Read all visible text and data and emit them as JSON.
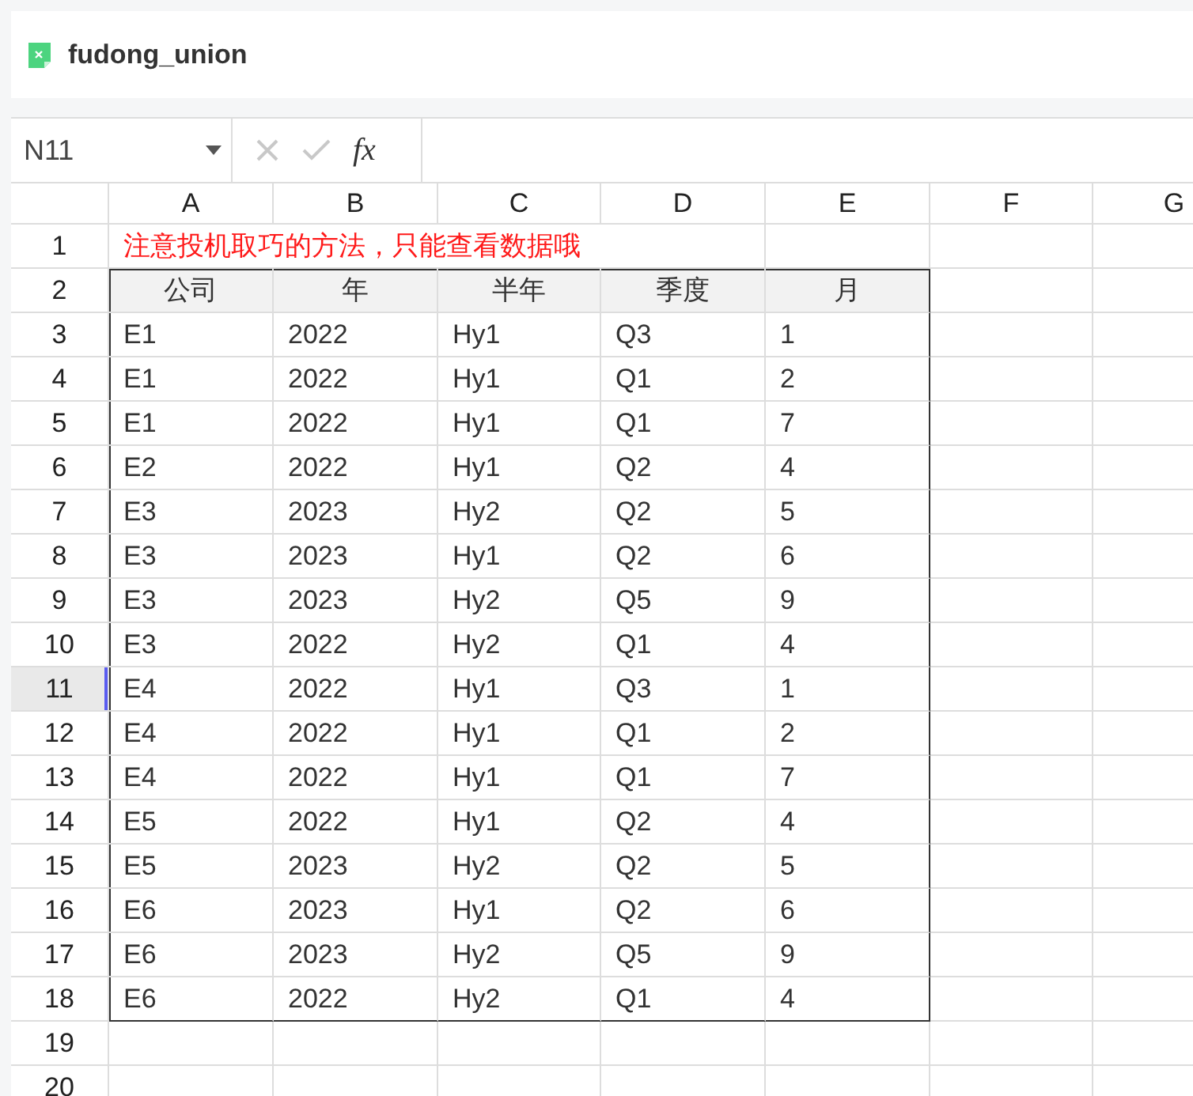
{
  "window": {
    "title": "fudong_union"
  },
  "formula_bar": {
    "name_box": "N11",
    "function_label": "fx"
  },
  "columns": [
    {
      "label": "A",
      "selected": false
    },
    {
      "label": "B",
      "selected": false
    },
    {
      "label": "C",
      "selected": false
    },
    {
      "label": "D",
      "selected": false
    },
    {
      "label": "E",
      "selected": false
    },
    {
      "label": "F",
      "selected": false
    },
    {
      "label": "G",
      "selected": false
    }
  ],
  "rows": [
    {
      "label": "1",
      "selected": false,
      "kind": "note",
      "cells": [
        "注意投机取巧的方法，只能查看数据哦"
      ]
    },
    {
      "label": "2",
      "selected": false,
      "kind": "header",
      "cells": [
        "公司",
        "年",
        "半年",
        "季度",
        "月"
      ]
    },
    {
      "label": "3",
      "selected": false,
      "kind": "data",
      "cells": [
        "E1",
        "2022",
        "Hy1",
        "Q3",
        "1"
      ]
    },
    {
      "label": "4",
      "selected": false,
      "kind": "data",
      "cells": [
        "E1",
        "2022",
        "Hy1",
        "Q1",
        "2"
      ]
    },
    {
      "label": "5",
      "selected": false,
      "kind": "data",
      "cells": [
        "E1",
        "2022",
        "Hy1",
        "Q1",
        "7"
      ]
    },
    {
      "label": "6",
      "selected": false,
      "kind": "data",
      "cells": [
        "E2",
        "2022",
        "Hy1",
        "Q2",
        "4"
      ]
    },
    {
      "label": "7",
      "selected": false,
      "kind": "data",
      "cells": [
        "E3",
        "2023",
        "Hy2",
        "Q2",
        "5"
      ]
    },
    {
      "label": "8",
      "selected": false,
      "kind": "data",
      "cells": [
        "E3",
        "2023",
        "Hy1",
        "Q2",
        "6"
      ]
    },
    {
      "label": "9",
      "selected": false,
      "kind": "data",
      "cells": [
        "E3",
        "2023",
        "Hy2",
        "Q5",
        "9"
      ]
    },
    {
      "label": "10",
      "selected": false,
      "kind": "data",
      "cells": [
        "E3",
        "2022",
        "Hy2",
        "Q1",
        "4"
      ]
    },
    {
      "label": "11",
      "selected": true,
      "kind": "data",
      "cells": [
        "E4",
        "2022",
        "Hy1",
        "Q3",
        "1"
      ]
    },
    {
      "label": "12",
      "selected": false,
      "kind": "data",
      "cells": [
        "E4",
        "2022",
        "Hy1",
        "Q1",
        "2"
      ]
    },
    {
      "label": "13",
      "selected": false,
      "kind": "data",
      "cells": [
        "E4",
        "2022",
        "Hy1",
        "Q1",
        "7"
      ]
    },
    {
      "label": "14",
      "selected": false,
      "kind": "data",
      "cells": [
        "E5",
        "2022",
        "Hy1",
        "Q2",
        "4"
      ]
    },
    {
      "label": "15",
      "selected": false,
      "kind": "data",
      "cells": [
        "E5",
        "2023",
        "Hy2",
        "Q2",
        "5"
      ]
    },
    {
      "label": "16",
      "selected": false,
      "kind": "data",
      "cells": [
        "E6",
        "2023",
        "Hy1",
        "Q2",
        "6"
      ]
    },
    {
      "label": "17",
      "selected": false,
      "kind": "data",
      "cells": [
        "E6",
        "2023",
        "Hy2",
        "Q5",
        "9"
      ]
    },
    {
      "label": "18",
      "selected": false,
      "kind": "data",
      "cells": [
        "E6",
        "2022",
        "Hy2",
        "Q1",
        "4"
      ]
    },
    {
      "label": "19",
      "selected": false,
      "kind": "empty",
      "cells": []
    },
    {
      "label": "20",
      "selected": false,
      "kind": "empty",
      "cells": []
    }
  ]
}
